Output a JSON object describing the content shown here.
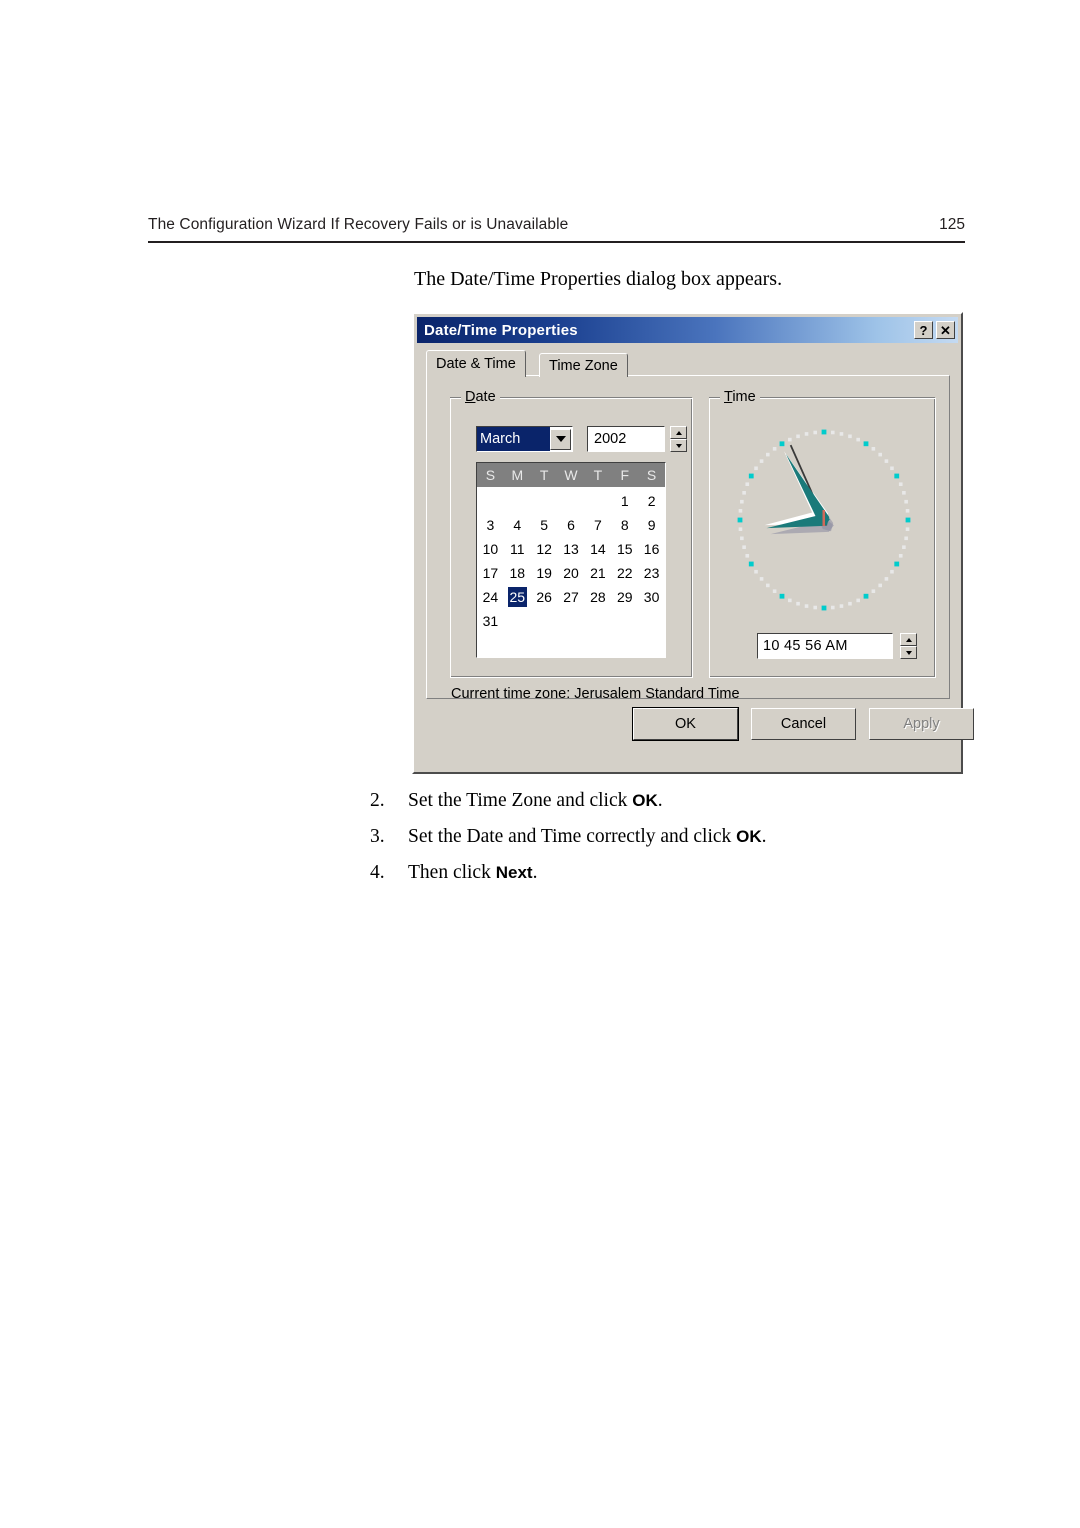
{
  "page": {
    "header_title": "The Configuration Wizard If Recovery Fails or is Unavailable",
    "page_number": "125",
    "intro": "The Date/Time Properties dialog box appears."
  },
  "dialog": {
    "title": "Date/Time Properties",
    "titlebar_buttons": [
      {
        "name": "help-button",
        "glyph": "?"
      },
      {
        "name": "close-button",
        "glyph": "✕"
      }
    ],
    "tabs": [
      {
        "label": "Date & Time",
        "active": true
      },
      {
        "label": "Time Zone",
        "active": false
      }
    ],
    "date_group": {
      "label": "Date",
      "month_value": "March",
      "year_value": "2002",
      "weekday_headers": [
        "S",
        "M",
        "T",
        "W",
        "T",
        "F",
        "S"
      ],
      "weeks": [
        [
          "",
          "",
          "",
          "",
          "",
          "1",
          "2"
        ],
        [
          "3",
          "4",
          "5",
          "6",
          "7",
          "8",
          "9"
        ],
        [
          "10",
          "11",
          "12",
          "13",
          "14",
          "15",
          "16"
        ],
        [
          "17",
          "18",
          "19",
          "20",
          "21",
          "22",
          "23"
        ],
        [
          "24",
          "25",
          "26",
          "27",
          "28",
          "29",
          "30"
        ],
        [
          "31",
          "",
          "",
          "",
          "",
          "",
          ""
        ]
      ],
      "selected_day": "25"
    },
    "time_group": {
      "label": "Time",
      "time_value": "10  45  56 AM",
      "clock": {
        "hour_angle": 262,
        "minute_angle": 330,
        "second_angle": 336,
        "hand_color": "#1a7a7a",
        "marker_major_color": "#00cccc",
        "marker_minor_color": "#e8e8e8"
      }
    },
    "timezone_line": "Current time zone:  Jerusalem Standard Time",
    "buttons": [
      {
        "label": "OK",
        "enabled": true,
        "default": true
      },
      {
        "label": "Cancel",
        "enabled": true,
        "default": false
      },
      {
        "label": "Apply",
        "enabled": false,
        "default": false
      }
    ],
    "colors": {
      "face": "#d4d0c8",
      "titlebar_start": "#0a246a",
      "titlebar_end": "#c4daf2",
      "selection": "#0a246a",
      "disabled_text": "#808080"
    }
  },
  "steps": [
    {
      "num": "2.",
      "pre": "Set the Time Zone and click ",
      "bold": "OK",
      "post": "."
    },
    {
      "num": "3.",
      "pre": "Set the Date and Time correctly and click ",
      "bold": "OK",
      "post": "."
    },
    {
      "num": "4.",
      "pre": "Then click ",
      "bold": "Next",
      "post": "."
    }
  ]
}
